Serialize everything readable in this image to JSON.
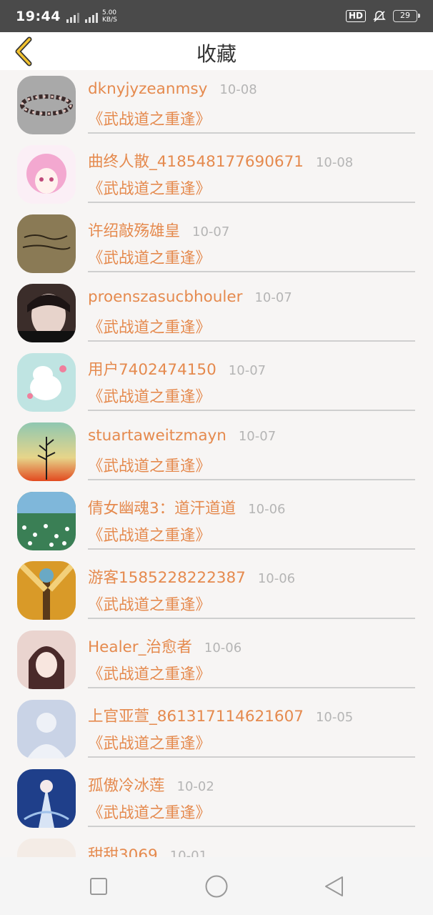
{
  "status_bar": {
    "time": "19:44",
    "network_speed_value": "5.00",
    "network_speed_unit": "KB/S",
    "hd_label": "HD",
    "battery": "29"
  },
  "header": {
    "title": "收藏"
  },
  "colors": {
    "accent": "#e58a4e",
    "date_gray": "#b5b5b5",
    "divider": "#cfcfcf",
    "status_bar_bg": "#4a4a4a"
  },
  "favorites": [
    {
      "username": "dknyjyzeanmsy",
      "date": "10-08",
      "book": "《武战道之重逢》"
    },
    {
      "username": "曲终人散_418548177690671",
      "date": "10-08",
      "book": "《武战道之重逢》"
    },
    {
      "username": "许绍敲殇雄皇",
      "date": "10-07",
      "book": "《武战道之重逢》"
    },
    {
      "username": "proenszasucbhouler",
      "date": "10-07",
      "book": "《武战道之重逢》"
    },
    {
      "username": "用户7402474150",
      "date": "10-07",
      "book": "《武战道之重逢》"
    },
    {
      "username": "stuartaweitzmayn",
      "date": "10-07",
      "book": "《武战道之重逢》"
    },
    {
      "username": "倩女幽魂3：道汗道道",
      "date": "10-06",
      "book": "《武战道之重逢》"
    },
    {
      "username": "游客1585228222387",
      "date": "10-06",
      "book": "《武战道之重逢》"
    },
    {
      "username": "Healer_治愈者",
      "date": "10-06",
      "book": "《武战道之重逢》"
    },
    {
      "username": "上官亚萱_861317114621607",
      "date": "10-05",
      "book": "《武战道之重逢》"
    },
    {
      "username": "孤傲冷冰莲",
      "date": "10-02",
      "book": "《武战道之重逢》"
    },
    {
      "username": "甜甜3069",
      "date": "10-01",
      "book": ""
    }
  ],
  "avatar_icons": [
    "bracelet-avatar-icon",
    "anime-girl-avatar-icon",
    "handwriting-avatar-icon",
    "girl-photo-avatar-icon",
    "moomin-avatar-icon",
    "sunset-plant-avatar-icon",
    "flower-field-avatar-icon",
    "forest-avatar-icon",
    "anime-portrait-avatar-icon",
    "default-person-avatar-icon",
    "ice-lotus-avatar-icon",
    "anime-girl-avatar-icon"
  ],
  "nav": {
    "recents_icon": "square-icon",
    "home_icon": "circle-icon",
    "back_icon": "triangle-back-icon"
  }
}
